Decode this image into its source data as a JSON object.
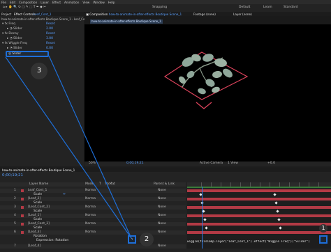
{
  "menu": [
    "File",
    "Edit",
    "Composition",
    "Layer",
    "Effect",
    "Animation",
    "View",
    "Window",
    "Help"
  ],
  "toolbar": {
    "snapping": "Snapping",
    "workspaces": [
      "Default",
      "Learn",
      "Standard"
    ]
  },
  "project_tab": "Project",
  "effect_controls": {
    "tab": "Effect Controls",
    "layer": "Leaf_Cont_1",
    "breadcrumb": "how-to-animate-in-after-effects Boutique Scene_1 - Leaf_Cont_1",
    "rows": [
      {
        "name": "Freq",
        "value": "Reset",
        "indent": 0
      },
      {
        "name": "Slider",
        "value": "2.00",
        "indent": 1
      },
      {
        "name": "Decay",
        "value": "Reset",
        "indent": 0
      },
      {
        "name": "Slider",
        "value": "3.00",
        "indent": 1
      },
      {
        "name": "Wiggle Freq",
        "value": "Reset",
        "indent": 0
      },
      {
        "name": "Slider",
        "value": "0.00",
        "indent": 1
      },
      {
        "name": "Slider",
        "value": "",
        "indent": 1
      }
    ]
  },
  "composition": {
    "tab": "Composition",
    "name": "how-to-animate-in-after-effects Boutique Scene_1",
    "subtab": "how-to-animate-in-after-effects Boutique Scene_1",
    "footage_tab": "Footage (none)",
    "layer_tab": "Layer (none)",
    "zoom": "50%",
    "timecode": "0;00;19;21",
    "view": "Active Camera",
    "views": "1 View",
    "exposure": "+0.0"
  },
  "timeline": {
    "tab": "how-to-animate-in-after-effects Boutique Scene_1",
    "timecode": "0;00;19;21",
    "columns": [
      "Layer Name",
      "Mode",
      "T",
      "TrkMat",
      "Parent & Link"
    ],
    "layers": [
      {
        "num": "1",
        "name": "Leaf_Cont_1",
        "mode": "Norma",
        "parent": "None"
      },
      {
        "num": "",
        "name": "Scale",
        "mode": "",
        "parent": ""
      },
      {
        "num": "2",
        "name": "[Leaf_2]",
        "mode": "Norma",
        "parent": "None"
      },
      {
        "num": "",
        "name": "Scale",
        "mode": "",
        "parent": ""
      },
      {
        "num": "3",
        "name": "[Leaf_Cont_2]",
        "mode": "Norma",
        "parent": "None"
      },
      {
        "num": "",
        "name": "Scale",
        "mode": "",
        "parent": ""
      },
      {
        "num": "4",
        "name": "[Leaf_1]",
        "mode": "Norma",
        "parent": "None"
      },
      {
        "num": "",
        "name": "Scale",
        "mode": "",
        "parent": ""
      },
      {
        "num": "5",
        "name": "[Leaf_Cont_3]",
        "mode": "Norma",
        "parent": "None"
      },
      {
        "num": "",
        "name": "Scale",
        "mode": "",
        "parent": ""
      },
      {
        "num": "6",
        "name": "[Leaf_3]",
        "mode": "Norma",
        "parent": "None"
      },
      {
        "num": "",
        "name": "Rotation",
        "mode": "",
        "parent": ""
      },
      {
        "num": "",
        "name": "Expression: Rotation",
        "mode": "",
        "parent": ""
      },
      {
        "num": "7",
        "name": "[Leaf_4]",
        "mode": "",
        "parent": "None"
      }
    ],
    "expression": "wiggle(thisComp.layer(\"Leaf_Cont_1\").effect(\"Wiggle Freq\")(\"Slider\")"
  },
  "callouts": [
    "1",
    "2",
    "3"
  ],
  "colors": {
    "callout_blue": "#1e6fd9",
    "track_red": "#b33a45",
    "leaf": "#8fa79a",
    "diamond": "#d9425a"
  }
}
